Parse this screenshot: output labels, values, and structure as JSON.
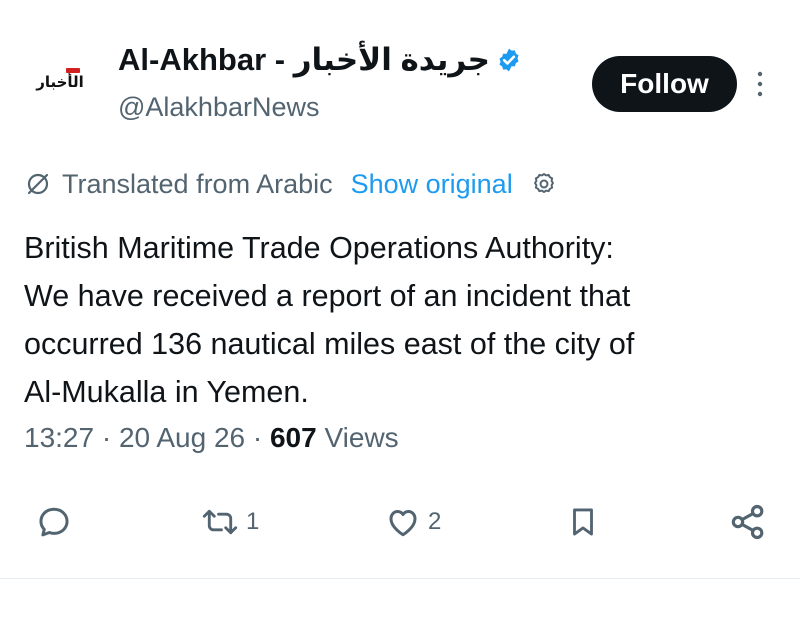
{
  "author": {
    "avatar_text": "الأخبار",
    "display_name": "Al-Akhbar - جريدة الأخبار",
    "handle": "@AlakhbarNews",
    "verified": true
  },
  "follow_label": "Follow",
  "translation": {
    "label": "Translated from Arabic",
    "show_original": "Show original"
  },
  "tweet": {
    "lines": [
      "British Maritime Trade Operations Authority:",
      "We have received a report of an incident that",
      "occurred 136 nautical miles east of the city of",
      "Al-Mukalla in Yemen."
    ],
    "time": "13:27",
    "date": "20 Aug 26",
    "views_count": "607",
    "views_label": "Views"
  },
  "actions": {
    "reply_count": "",
    "retweet_count": "1",
    "like_count": "2"
  },
  "colors": {
    "text": "#0f1419",
    "secondary": "#536471",
    "link": "#1d9bf0",
    "verified": "#1d9bf0"
  },
  "icons": [
    "verified-badge-icon",
    "more-icon",
    "translate-icon",
    "gear-icon",
    "reply-icon",
    "retweet-icon",
    "like-icon",
    "bookmark-icon",
    "share-icon"
  ]
}
